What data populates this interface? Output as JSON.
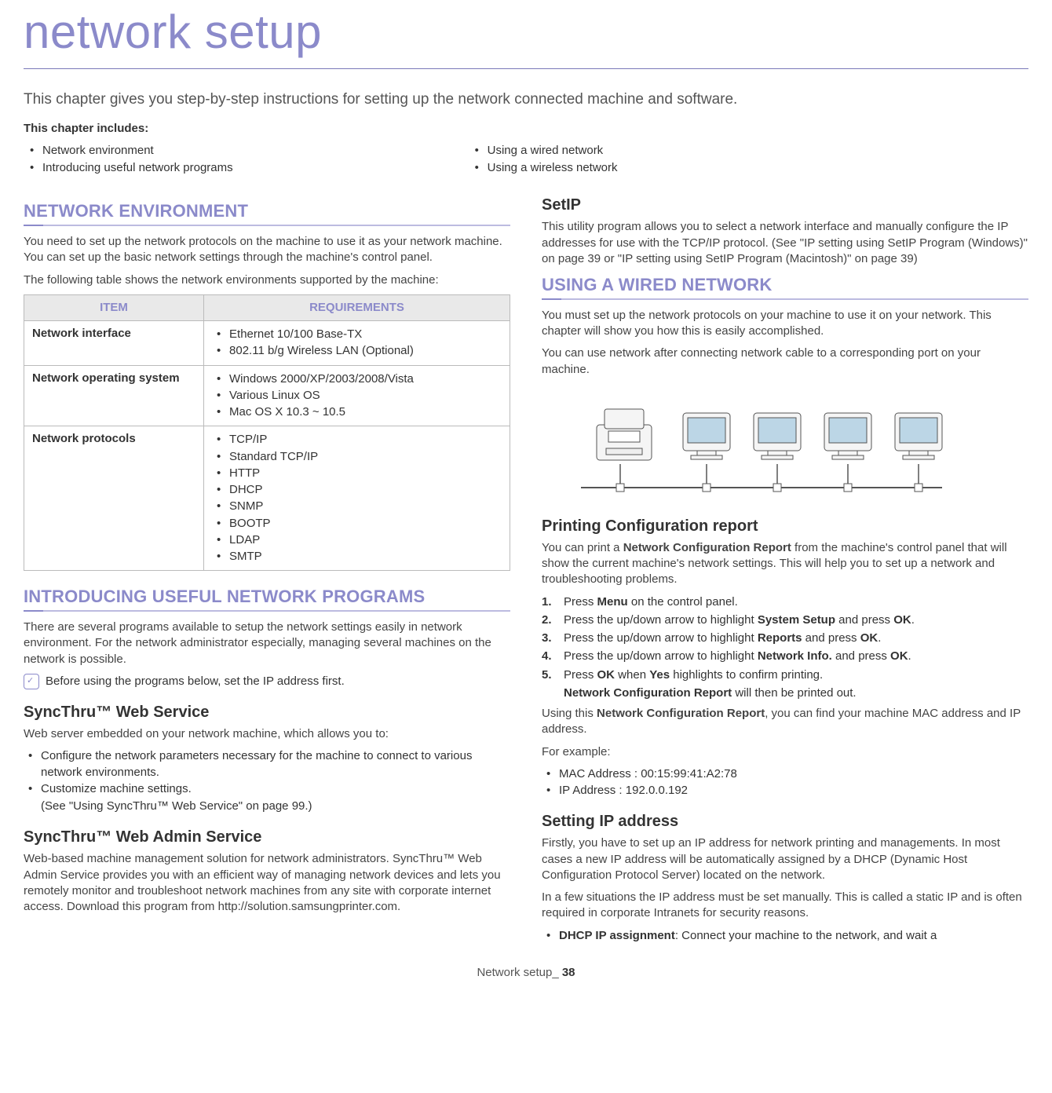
{
  "title": "network setup",
  "intro": "This chapter gives you step-by-step instructions for setting up the network connected machine and software.",
  "includes_label": "This chapter includes:",
  "toc_left": [
    "Network environment",
    "Introducing useful network programs"
  ],
  "toc_right": [
    "Using a wired network",
    "Using a wireless network"
  ],
  "sec_env": {
    "heading": "NETWORK ENVIRONMENT",
    "p1": "You need to set up the network protocols on the machine to use it as your network machine. You can set up the basic network settings through the machine's control panel.",
    "p2": "The following table shows the network environments supported by the machine:",
    "table": {
      "col1": "ITEM",
      "col2": "REQUIREMENTS",
      "rows": [
        {
          "label": "Network interface",
          "items": [
            "Ethernet 10/100 Base-TX",
            "802.11 b/g Wireless LAN (Optional)"
          ]
        },
        {
          "label": "Network operating system",
          "items": [
            "Windows 2000/XP/2003/2008/Vista",
            "Various Linux OS",
            "Mac OS X 10.3 ~ 10.5"
          ]
        },
        {
          "label": "Network protocols",
          "items": [
            "TCP/IP",
            "Standard TCP/IP",
            "HTTP",
            "DHCP",
            "SNMP",
            "BOOTP",
            "LDAP",
            "SMTP"
          ]
        }
      ]
    }
  },
  "sec_programs": {
    "heading": "INTRODUCING USEFUL NETWORK PROGRAMS",
    "p1": "There are several programs available to setup the network settings easily in network environment. For the network administrator especially, managing several machines on the network is possible.",
    "note": "Before using the programs below, set the IP address first.",
    "syncthru": {
      "heading": "SyncThru™ Web Service",
      "p1": "Web server embedded on your network machine, which allows you to:",
      "items": [
        "Configure the network parameters necessary for the machine to connect to various network environments.",
        "Customize machine settings."
      ],
      "ref": "(See \"Using SyncThru™ Web Service\" on page 99.)"
    },
    "admin": {
      "heading": "SyncThru™ Web Admin Service",
      "p1": "Web-based machine management solution for network administrators. SyncThru™ Web Admin Service provides you with an efficient way of managing network devices and lets you remotely monitor and troubleshoot network machines from any site with corporate internet access. Download this program from http://solution.samsungprinter.com."
    }
  },
  "sec_setip": {
    "heading": "SetIP",
    "p1": "This utility program allows you to select a network interface and manually configure the IP addresses for use with the TCP/IP protocol. (See \"IP setting using SetIP Program (Windows)\" on page 39 or \"IP setting using SetIP Program (Macintosh)\" on page 39)"
  },
  "sec_wired": {
    "heading": "USING A WIRED NETWORK",
    "p1": "You must set up the network protocols on your machine to use it on your network.  This chapter will show you how this is easily accomplished.",
    "p2": "You can use network after connecting network cable to a corresponding port on your machine.",
    "config_report": {
      "heading": "Printing Configuration report",
      "p1_a": "You can print a ",
      "p1_b": "Network Configuration Report",
      "p1_c": " from the machine's control panel that will show the current machine's network settings. This will help you to set up a network and troubleshooting problems.",
      "steps": [
        {
          "pre": "Press ",
          "b1": "Menu",
          "post": " on the control panel."
        },
        {
          "pre": "Press the up/down arrow to highlight ",
          "b1": "System Setup",
          "mid": " and press ",
          "b2": "OK",
          "post": "."
        },
        {
          "pre": "Press the up/down arrow to highlight ",
          "b1": "Reports",
          "mid": " and press ",
          "b2": "OK",
          "post": "."
        },
        {
          "pre": "Press the up/down arrow to highlight ",
          "b1": "Network Info.",
          "mid": " and press ",
          "b2": "OK",
          "post": "."
        },
        {
          "pre": "Press ",
          "b1": "OK",
          "mid": " when ",
          "b2": "Yes",
          "post": " highlights to confirm printing.",
          "sub_b": "Network Configuration Report",
          "sub_post": " will then be printed out."
        }
      ],
      "p2_a": "Using this ",
      "p2_b": "Network Configuration Report",
      "p2_c": ", you can find your machine MAC address and IP address.",
      "example_label": "For example:",
      "examples": [
        "MAC Address : 00:15:99:41:A2:78",
        "IP Address : 192.0.0.192"
      ]
    },
    "setting_ip": {
      "heading": "Setting IP address",
      "p1": "Firstly, you have to set up an IP address for network printing and managements. In most cases a new IP address will be automatically assigned by a DHCP (Dynamic Host Configuration Protocol Server) located on the network.",
      "p2": "In a few situations the IP address must be set manually.  This is called a static IP and is often required in corporate Intranets for security reasons.",
      "bullet_b": "DHCP IP assignment",
      "bullet_post": ": Connect your machine to the network, and wait a"
    }
  },
  "footer": {
    "label": "Network setup_ ",
    "page": "38"
  }
}
